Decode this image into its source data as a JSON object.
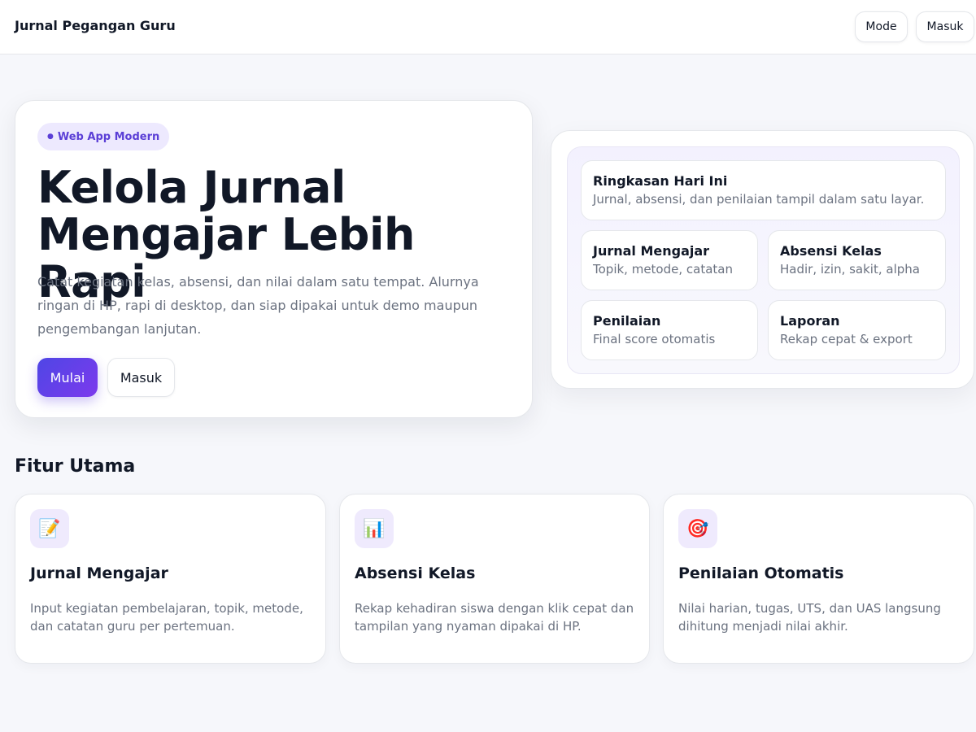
{
  "header": {
    "brand": "Jurnal Pegangan Guru",
    "mode_label": "Mode",
    "login_label": "Masuk"
  },
  "hero": {
    "badge": "Web App Modern",
    "title": "Kelola Jurnal Mengajar Lebih Rapi",
    "description": "Catat kegiatan kelas, absensi, dan nilai dalam satu tempat. Alurnya ringan di HP, rapi di desktop, dan siap dipakai untuk demo maupun pengembangan lanjutan.",
    "primary_label": "Mulai",
    "secondary_label": "Masuk"
  },
  "preview": {
    "summary": {
      "title": "Ringkasan Hari Ini",
      "subtitle": "Jurnal, absensi, dan penilaian tampil dalam satu layar."
    },
    "cards": [
      {
        "title": "Jurnal Mengajar",
        "subtitle": "Topik, metode, catatan"
      },
      {
        "title": "Absensi Kelas",
        "subtitle": "Hadir, izin, sakit, alpha"
      },
      {
        "title": "Penilaian",
        "subtitle": "Final score otomatis"
      },
      {
        "title": "Laporan",
        "subtitle": "Rekap cepat & export"
      }
    ]
  },
  "features": {
    "section_title": "Fitur Utama",
    "items": [
      {
        "icon": "memo-icon",
        "glyph": "📝",
        "title": "Jurnal Mengajar",
        "description": "Input kegiatan pembelajaran, topik, metode, dan catatan guru per pertemuan."
      },
      {
        "icon": "bar-chart-icon",
        "glyph": "📊",
        "title": "Absensi Kelas",
        "description": "Rekap kehadiran siswa dengan klik cepat dan tampilan yang nyaman dipakai di HP."
      },
      {
        "icon": "target-icon",
        "glyph": "🎯",
        "title": "Penilaian Otomatis",
        "description": "Nilai harian, tugas, UTS, dan UAS langsung dihitung menjadi nilai akhir."
      }
    ]
  },
  "colors": {
    "accent": "#5b3fd6",
    "primary_gradient_start": "#4f46e5",
    "primary_gradient_end": "#7c3aed",
    "background": "#f6f7fb"
  }
}
